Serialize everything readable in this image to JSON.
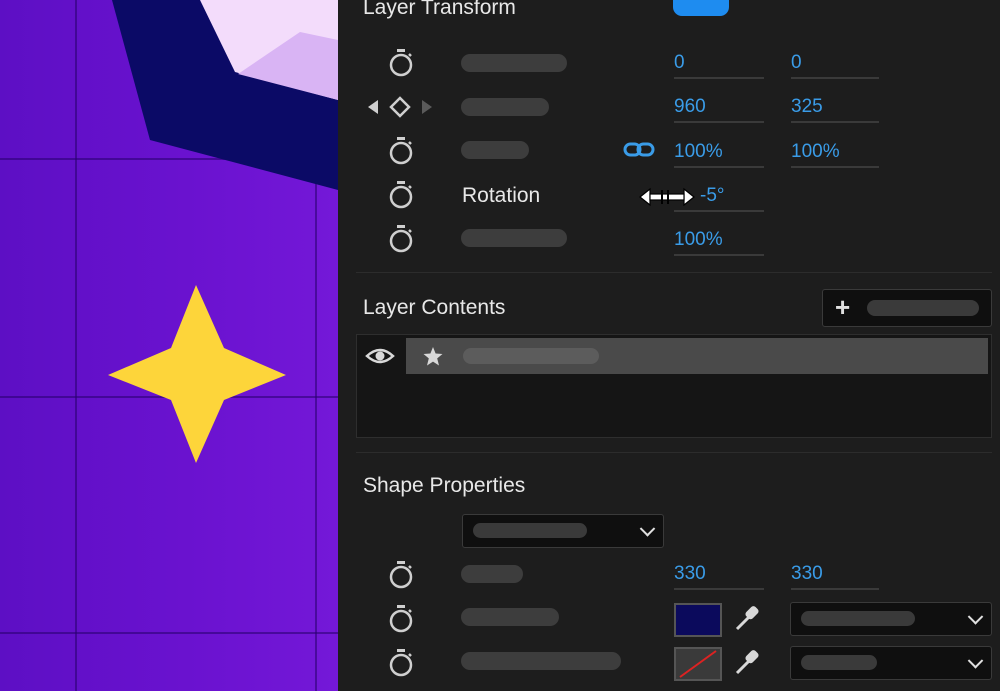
{
  "canvas": {
    "background_color": "#6412cc",
    "star_color": "#fdd53a",
    "shape_colors": [
      "#0b0a66",
      "#f3dcfb",
      "#d9b4f4"
    ]
  },
  "layer_transform": {
    "title": "Layer Transform",
    "toggle_color": "#1e8cf0",
    "anchor_x": "0",
    "anchor_y": "0",
    "position_x": "960",
    "position_y": "325",
    "scale_x": "100%",
    "scale_y": "100%",
    "rotation_label": "Rotation",
    "rotation_value": "-5°",
    "opacity_value": "100%"
  },
  "layer_contents": {
    "title": "Layer Contents",
    "add_icon": "+",
    "items": [
      {
        "icon": "star-icon",
        "visibility": "eye-icon"
      }
    ]
  },
  "shape_properties": {
    "title": "Shape Properties",
    "size_w": "330",
    "size_h": "330",
    "fill_color": "#0b0a5c",
    "stroke_color": "none"
  },
  "accent_color": "#3a9ce8"
}
